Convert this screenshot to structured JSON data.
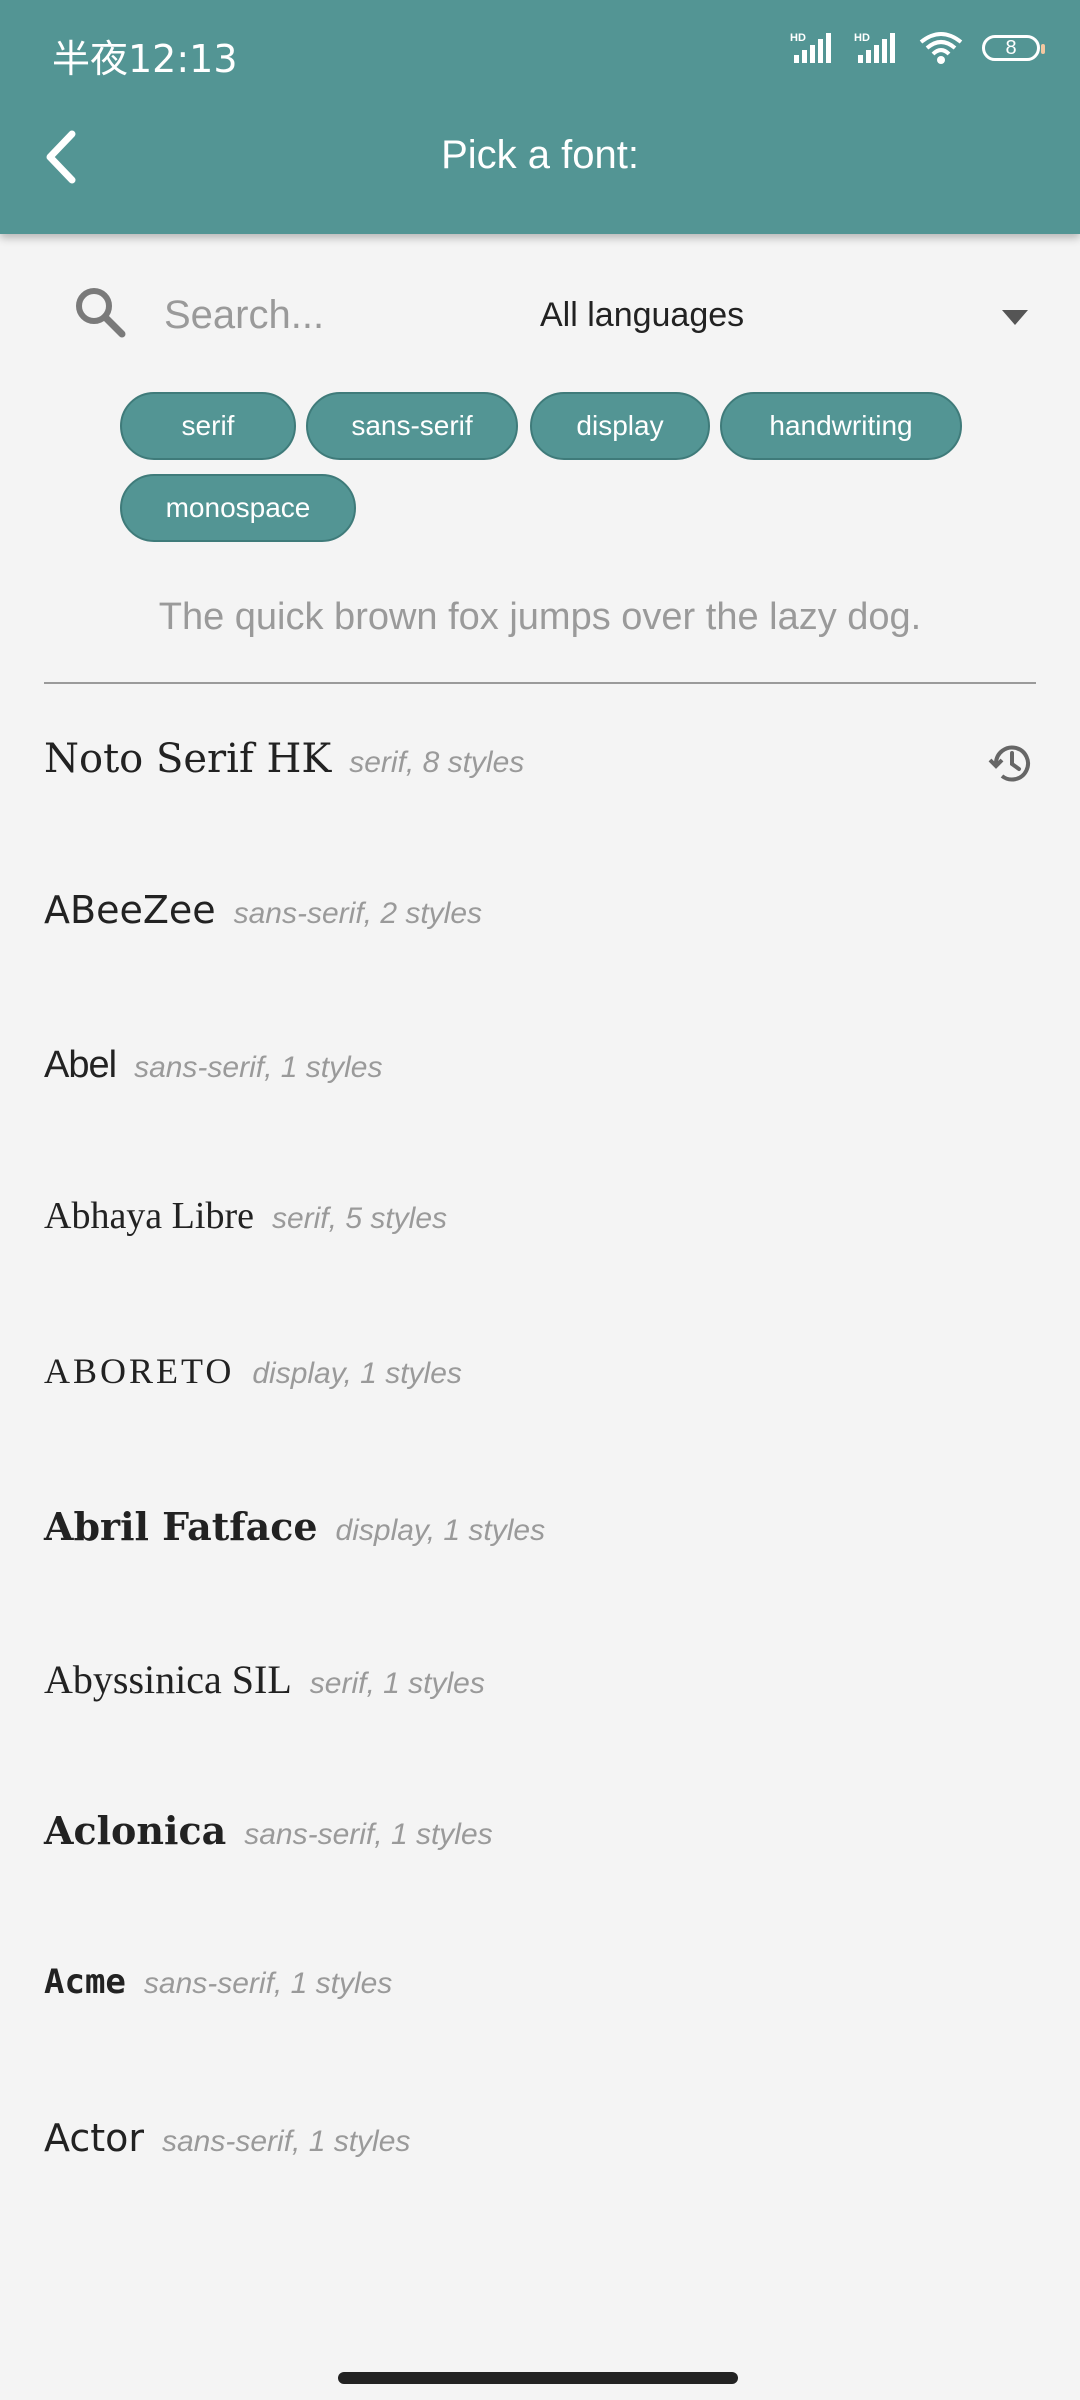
{
  "status": {
    "time": "半夜12:13",
    "battery": "8"
  },
  "header": {
    "title": "Pick a font:"
  },
  "search": {
    "placeholder": "Search..."
  },
  "language_filter": {
    "selected": "All languages"
  },
  "chips": [
    "serif",
    "sans-serif",
    "display",
    "handwriting",
    "monospace"
  ],
  "sample_text": "The quick brown fox jumps over the lazy dog.",
  "fonts": [
    {
      "name": "Noto Serif HK",
      "meta": "serif, 8 styles"
    },
    {
      "name": "ABeeZee",
      "meta": "sans-serif, 2 styles"
    },
    {
      "name": "Abel",
      "meta": "sans-serif, 1 styles"
    },
    {
      "name": "Abhaya Libre",
      "meta": "serif, 5 styles"
    },
    {
      "name": "ABORETO",
      "meta": "display, 1 styles"
    },
    {
      "name": "Abril Fatface",
      "meta": "display, 1 styles"
    },
    {
      "name": "Abyssinica SIL",
      "meta": "serif, 1 styles"
    },
    {
      "name": "Aclonica",
      "meta": "sans-serif, 1 styles"
    },
    {
      "name": "Acme",
      "meta": "sans-serif, 1 styles"
    },
    {
      "name": "Actor",
      "meta": "sans-serif, 1 styles"
    }
  ],
  "colors": {
    "accent": "#539594",
    "background": "#f4f4f4",
    "muted_text": "#9a9a9a"
  },
  "icons": [
    "back-arrow-icon",
    "search-icon",
    "dropdown-arrow-icon",
    "history-icon"
  ]
}
